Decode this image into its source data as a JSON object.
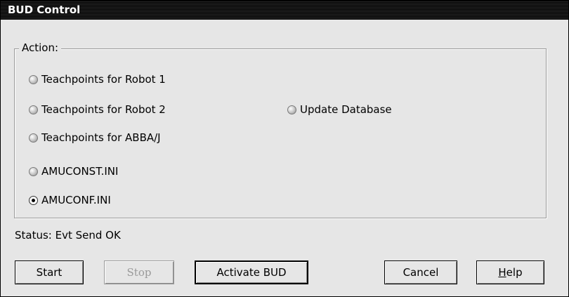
{
  "window": {
    "title": "BUD Control"
  },
  "action_group": {
    "label": "Action:",
    "options": [
      {
        "label": "Teachpoints for Robot 1",
        "checked": false
      },
      {
        "label": "Teachpoints for Robot 2",
        "checked": false
      },
      {
        "label": "Teachpoints for ABBA/J",
        "checked": false
      },
      {
        "label": "AMUCONST.INI",
        "checked": false
      },
      {
        "label": "AMUCONF.INI",
        "checked": true
      },
      {
        "label": "Update Database",
        "checked": false
      }
    ]
  },
  "status": {
    "text": "Status: Evt Send OK"
  },
  "buttons": {
    "start": "Start",
    "stop": "Stop",
    "activate": "Activate BUD",
    "cancel": "Cancel",
    "help_prefix": "H",
    "help_rest": "elp"
  }
}
